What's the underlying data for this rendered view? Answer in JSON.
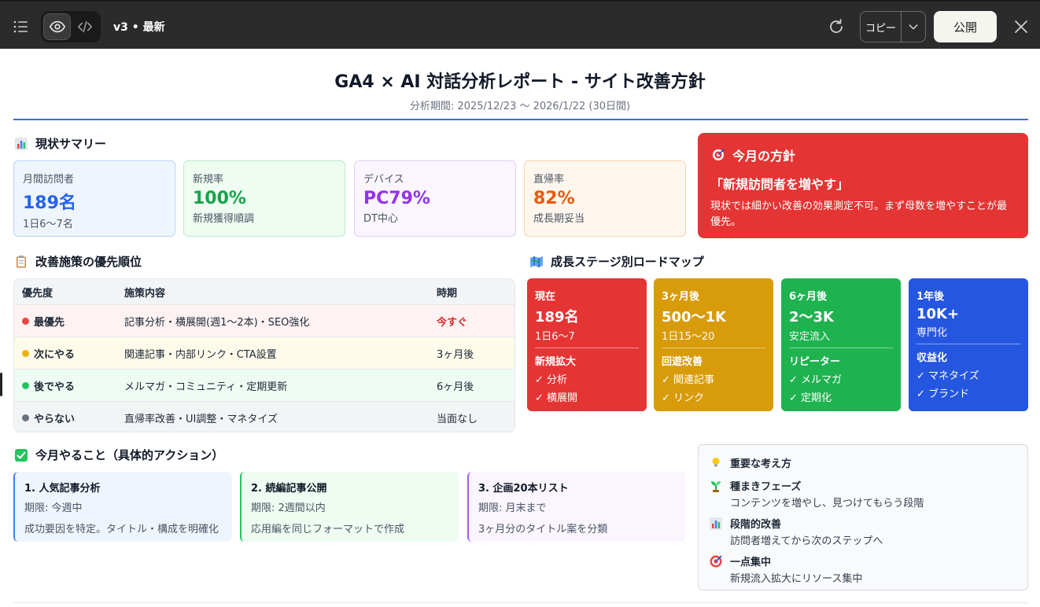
{
  "topbar": {
    "version": "v3 • 最新",
    "copy_label": "コピー",
    "publish_label": "公開"
  },
  "header": {
    "title": "GA4 × AI 対話分析レポート - サイト改善方針",
    "subtitle": "分析期間: 2025/12/23 〜 2026/1/22 (30日間)"
  },
  "summary": {
    "heading": "現状サマリー",
    "cards": [
      {
        "label": "月間訪問者",
        "value": "189名",
        "sub": "1日6〜7名",
        "color": "#2563eb",
        "bg": "#eff5ff",
        "border": "#bcd2f7"
      },
      {
        "label": "新規率",
        "value": "100%",
        "sub": "新規獲得順調",
        "color": "#16a34a",
        "bg": "#eefcf2",
        "border": "#bde9ca"
      },
      {
        "label": "デバイス",
        "value": "PC79%",
        "sub": "DT中心",
        "color": "#9333ea",
        "bg": "#faf5ff",
        "border": "#e3cff7"
      },
      {
        "label": "直帰率",
        "value": "82%",
        "sub": "成長期妥当",
        "color": "#ea580c",
        "bg": "#fff7ed",
        "border": "#f8d6b3"
      }
    ]
  },
  "policy": {
    "heading": "今月の方針",
    "quote": "「新規訪問者を増やす」",
    "desc": "現状では細かい改善の効果測定不可。まず母数を増やすことが最優先。"
  },
  "priority": {
    "heading": "改善施策の優先順位",
    "columns": [
      "優先度",
      "施策内容",
      "時期"
    ],
    "rows": [
      {
        "level": "最優先",
        "content": "記事分析・横展開(週1〜2本)・SEO強化",
        "timing": "今すぐ",
        "dot": "#ef4444",
        "bg": "#fef2f2",
        "timing_color": "#dc2626"
      },
      {
        "level": "次にやる",
        "content": "関連記事・内部リンク・CTA設置",
        "timing": "3ヶ月後",
        "dot": "#eab308",
        "bg": "#fefbea",
        "timing_color": "#1f2937"
      },
      {
        "level": "後でやる",
        "content": "メルマガ・コミュニティ・定期更新",
        "timing": "6ヶ月後",
        "dot": "#22c55e",
        "bg": "#effcf3",
        "timing_color": "#1f2937"
      },
      {
        "level": "やらない",
        "content": "直帰率改善・UI調整・マネタイズ",
        "timing": "当面なし",
        "dot": "#6b7280",
        "bg": "#f3f4f6",
        "timing_color": "#1f2937"
      }
    ]
  },
  "roadmap": {
    "heading": "成長ステージ別ロードマップ",
    "stages": [
      {
        "label": "現在",
        "value": "189名",
        "sub": "1日6〜7",
        "goal": "新規拡大",
        "items": [
          "✓ 分析",
          "✓ 横展開"
        ],
        "color": "#e53434"
      },
      {
        "label": "3ヶ月後",
        "value": "500〜1K",
        "sub": "1日15〜20",
        "goal": "回遊改善",
        "items": [
          "✓ 関連記事",
          "✓ リンク"
        ],
        "color": "#d89b0a"
      },
      {
        "label": "6ヶ月後",
        "value": "2〜3K",
        "sub": "安定流入",
        "goal": "リピーター",
        "items": [
          "✓ メルマガ",
          "✓ 定期化"
        ],
        "color": "#1fb350"
      },
      {
        "label": "1年後",
        "value": "10K+",
        "sub": "専門化",
        "goal": "収益化",
        "items": [
          "✓ マネタイズ",
          "✓ ブランド"
        ],
        "color": "#2556e0"
      }
    ]
  },
  "actions": {
    "heading": "今月やること（具体的アクション）",
    "items": [
      {
        "title": "1. 人気記事分析",
        "deadline": "期限: 今週中",
        "note": "成功要因を特定。タイトル・構成を明確化",
        "accent": "#3b82f6",
        "bg": "#eff5ff"
      },
      {
        "title": "2. 続編記事公開",
        "deadline": "期限: 2週間以内",
        "note": "応用編を同じフォーマットで作成",
        "accent": "#22c55e",
        "bg": "#eefcf2"
      },
      {
        "title": "3. 企画20本リスト",
        "deadline": "期限: 月末まで",
        "note": "3ヶ月分のタイトル案を分類",
        "accent": "#a855f7",
        "bg": "#faf5ff"
      }
    ]
  },
  "principles": {
    "heading": "重要な考え方",
    "items": [
      {
        "title": "種まきフェーズ",
        "desc": "コンテンツを増やし、見つけてもらう段階",
        "icon": "seedling-icon"
      },
      {
        "title": "段階的改善",
        "desc": "訪問者増えてから次のステップへ",
        "icon": "bar-chart-icon"
      },
      {
        "title": "一点集中",
        "desc": "新規流入拡大にリソース集中",
        "icon": "target-icon"
      }
    ]
  }
}
